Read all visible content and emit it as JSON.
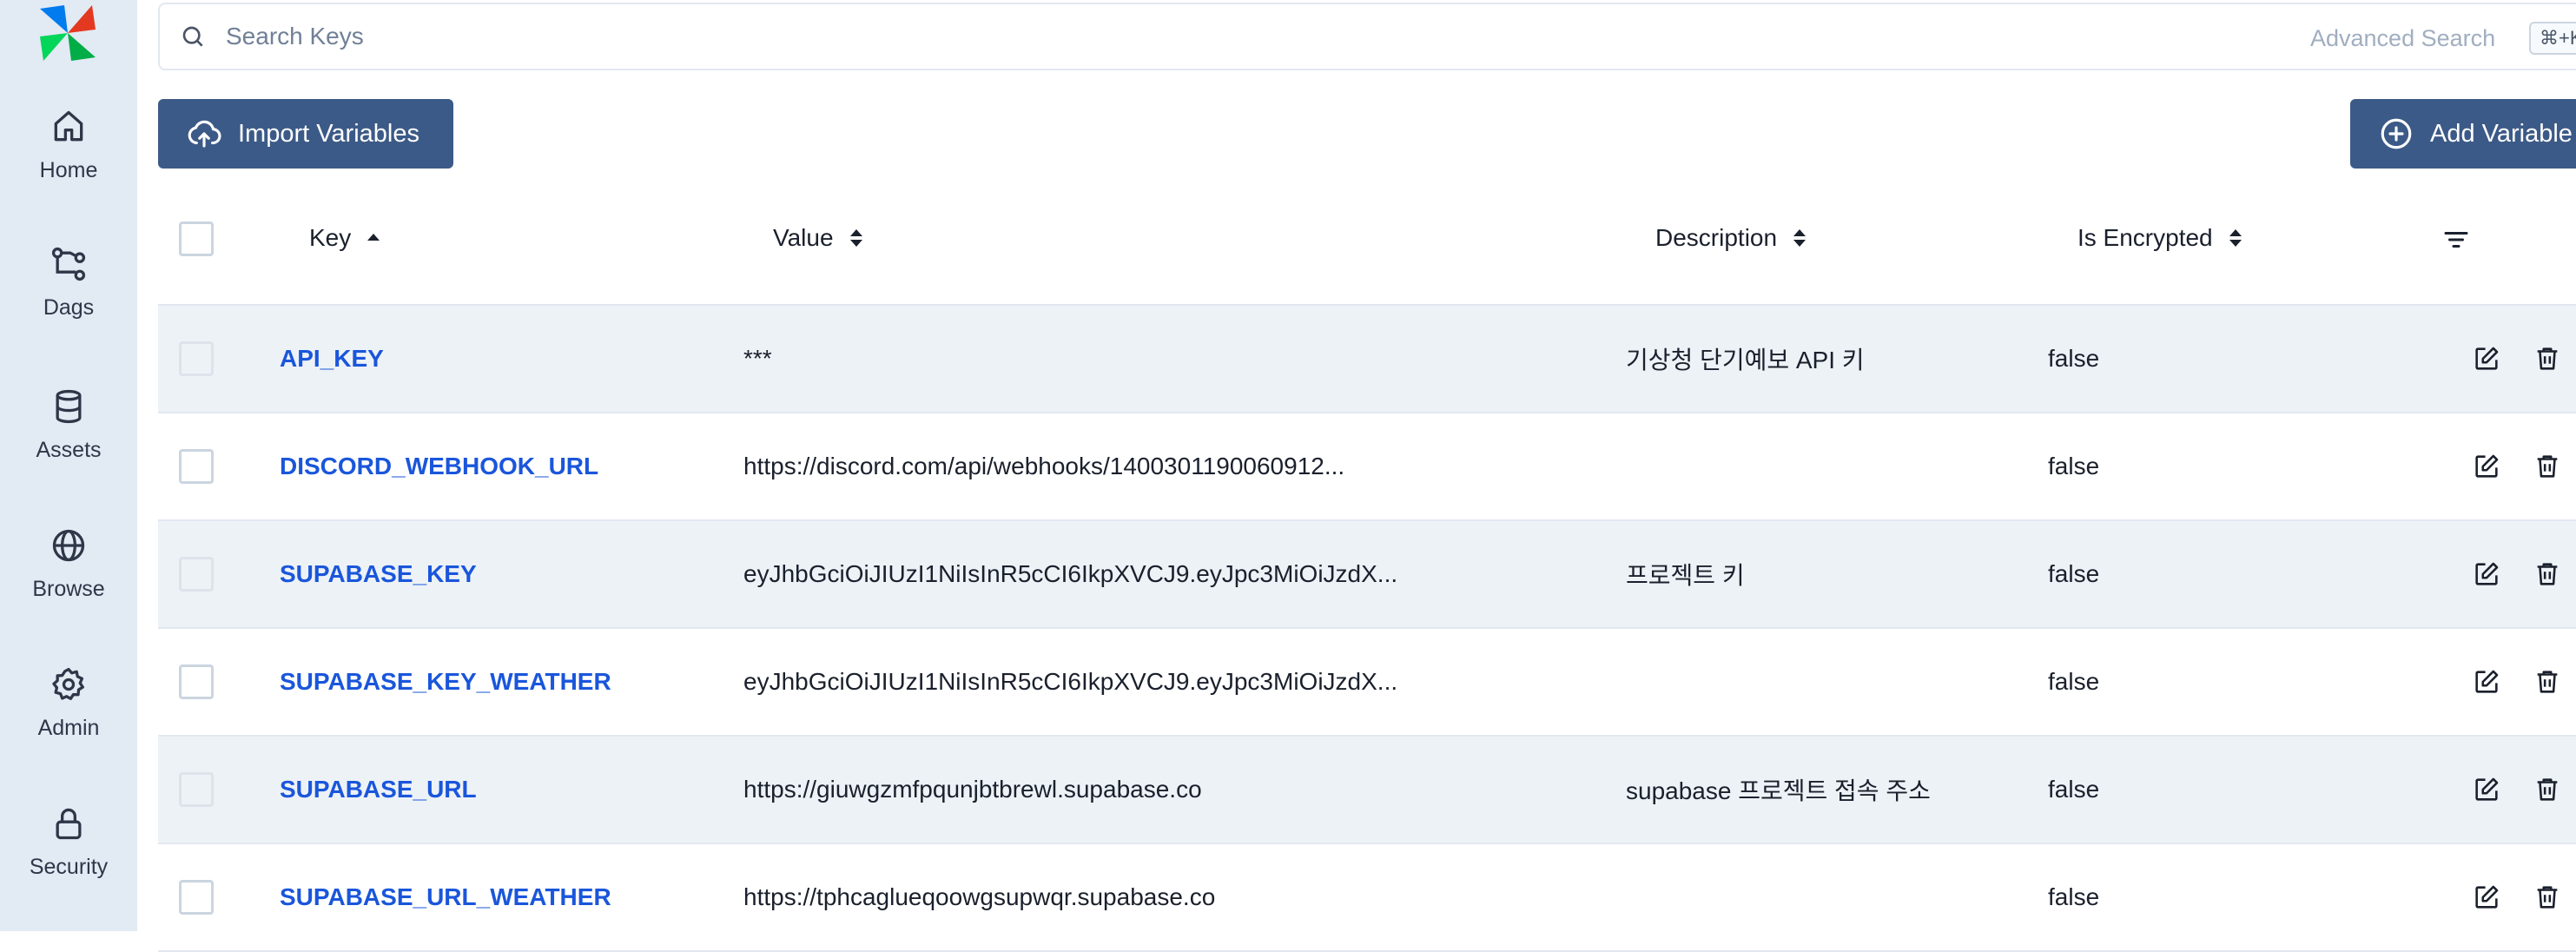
{
  "sidebar": {
    "logo_icon": "airflow-pinwheel-logo",
    "items": [
      {
        "label": "Home",
        "icon": "home-icon"
      },
      {
        "label": "Dags",
        "icon": "dags-icon"
      },
      {
        "label": "Assets",
        "icon": "database-icon"
      },
      {
        "label": "Browse",
        "icon": "globe-icon"
      },
      {
        "label": "Admin",
        "icon": "gear-icon"
      },
      {
        "label": "Security",
        "icon": "lock-icon"
      }
    ]
  },
  "search": {
    "placeholder": "Search Keys",
    "value": "",
    "advanced_label": "Advanced Search",
    "shortcut": "⌘+K"
  },
  "toolbar": {
    "import_label": "Import Variables",
    "add_label": "Add Variable"
  },
  "table": {
    "columns": [
      "Key",
      "Value",
      "Description",
      "Is Encrypted"
    ],
    "sort": {
      "column": "Key",
      "direction": "ascending"
    },
    "rows": [
      {
        "key": "API_KEY",
        "value": "***",
        "description": "기상청 단기예보 API 키",
        "encrypted": "false"
      },
      {
        "key": "DISCORD_WEBHOOK_URL",
        "value": "https://discord.com/api/webhooks/1400301190060912...",
        "description": "",
        "encrypted": "false"
      },
      {
        "key": "SUPABASE_KEY",
        "value": "eyJhbGciOiJIUzI1NiIsInR5cCI6IkpXVCJ9.eyJpc3MiOiJzdX...",
        "description": "프로젝트 키",
        "encrypted": "false"
      },
      {
        "key": "SUPABASE_KEY_WEATHER",
        "value": "eyJhbGciOiJIUzI1NiIsInR5cCI6IkpXVCJ9.eyJpc3MiOiJzdX...",
        "description": "",
        "encrypted": "false"
      },
      {
        "key": "SUPABASE_URL",
        "value": "https://giuwgzmfpqunjbtbrewl.supabase.co",
        "description": "supabase 프로젝트 접속 주소",
        "encrypted": "false"
      },
      {
        "key": "SUPABASE_URL_WEATHER",
        "value": "https://tphcaglueqoowgsupwqr.supabase.co",
        "description": "",
        "encrypted": "false"
      }
    ]
  },
  "colors": {
    "sidebar_bg": "#e2eaf4",
    "primary_button": "#3c5a87",
    "key_link": "#1a56db",
    "row_stripe": "#edf2f7"
  }
}
